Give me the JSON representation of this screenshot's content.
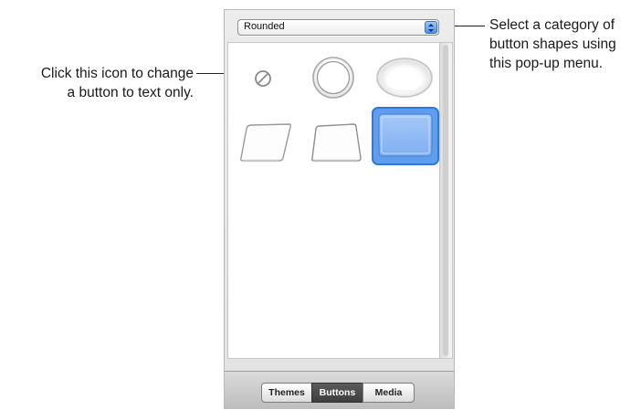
{
  "callouts": {
    "left": {
      "line1": "Click this icon to change",
      "line2": "a button to text only."
    },
    "right": {
      "line1": "Select a category of",
      "line2": "button shapes using",
      "line3": "this pop-up menu."
    }
  },
  "panel": {
    "popup": {
      "selected": "Rounded"
    },
    "grid": {
      "items": [
        {
          "name": "no-shape-text-only",
          "icon": "prohibited-circle-icon",
          "selected": false
        },
        {
          "name": "circle",
          "icon": "circle-shape",
          "selected": false
        },
        {
          "name": "oval",
          "icon": "oval-shape",
          "selected": false
        },
        {
          "name": "slanted-rect",
          "icon": "slanted-rect-shape",
          "selected": false
        },
        {
          "name": "trapezoid",
          "icon": "trapezoid-shape",
          "selected": false
        },
        {
          "name": "rounded-rect",
          "icon": "rounded-rect-shape",
          "selected": true
        }
      ]
    },
    "tabs": [
      {
        "label": "Themes",
        "active": false
      },
      {
        "label": "Buttons",
        "active": true
      },
      {
        "label": "Media",
        "active": false
      }
    ]
  },
  "colors": {
    "selection_blue": "#4a8fe6",
    "selection_fill": "#86b4f5"
  }
}
